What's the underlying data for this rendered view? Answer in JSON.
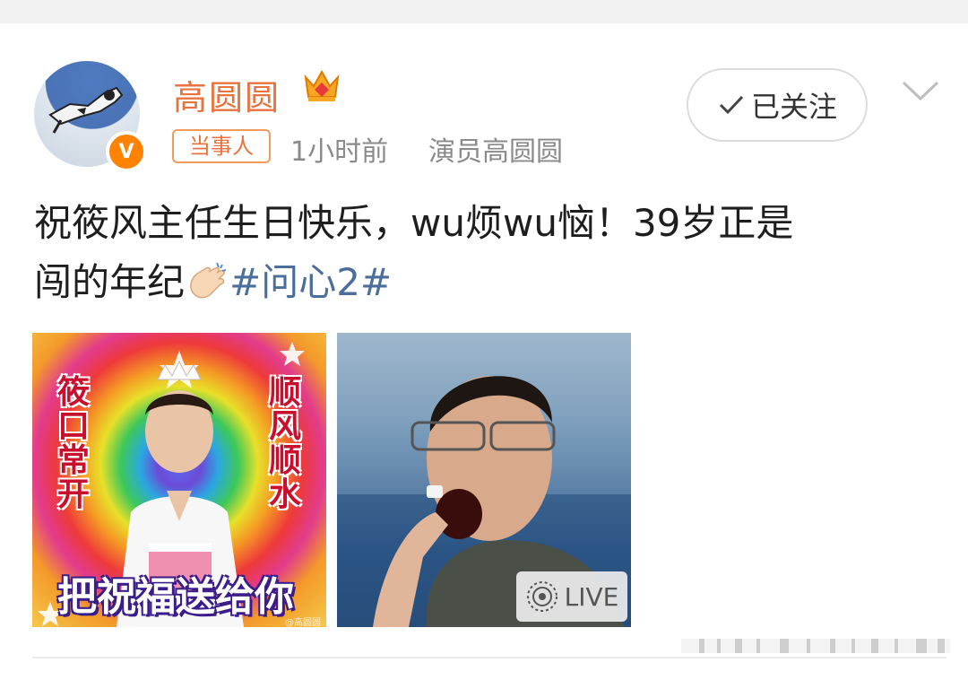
{
  "post": {
    "user": {
      "name": "高圆圆",
      "verified_mark": "V",
      "avatar_icon": "cat-avatar",
      "crown_icon": "crown-icon"
    },
    "tag": "当事人",
    "time": "1小时前",
    "source": "演员高圆圆",
    "follow_label": "已关注",
    "text_line1": "祝筱风主任生日快乐，wu烦wu恼！39岁正是",
    "text_line2": "闯的年纪",
    "hashtag": "#问心2#",
    "image1": {
      "left_text": "筱口常开",
      "right_text": "顺风顺水",
      "bottom_text": "把祝福送给你",
      "watermark": "@高圆圆"
    },
    "image2": {
      "live_label": "LIVE"
    }
  },
  "colors": {
    "accent_orange": "#e8733f",
    "hashtag_blue": "#4b6e9a",
    "verified_orange": "#ff8200"
  }
}
